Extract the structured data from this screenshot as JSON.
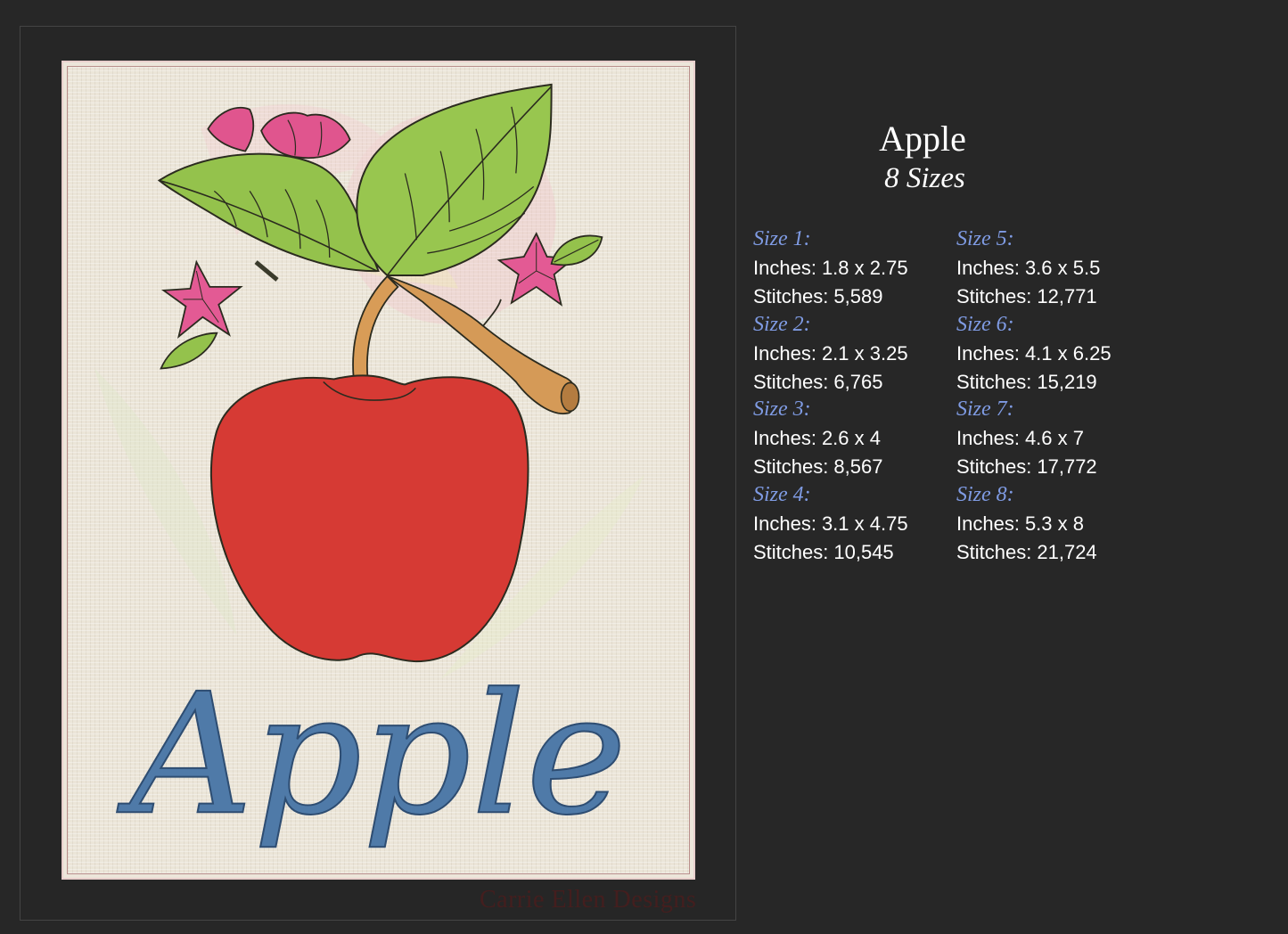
{
  "design": {
    "embroidered_text": "Apple",
    "watermark": "Carrie Ellen Designs"
  },
  "info": {
    "title": "Apple",
    "subtitle": "8 Sizes",
    "inches_label": "Inches:",
    "stitches_label": "Stitches:",
    "sizes": [
      {
        "label": "Size 1:",
        "inches": "1.8 x 2.75",
        "stitches": "5,589"
      },
      {
        "label": "Size 2:",
        "inches": "2.1 x 3.25",
        "stitches": "6,765"
      },
      {
        "label": "Size 3:",
        "inches": "2.6 x 4",
        "stitches": "8,567"
      },
      {
        "label": "Size 4:",
        "inches": "3.1 x 4.75",
        "stitches": "10,545"
      },
      {
        "label": "Size 5:",
        "inches": "3.6 x 5.5",
        "stitches": "12,771"
      },
      {
        "label": "Size 6:",
        "inches": "4.1 x 6.25",
        "stitches": "15,219"
      },
      {
        "label": "Size 7:",
        "inches": "4.6 x 7",
        "stitches": "17,772"
      },
      {
        "label": "Size 8:",
        "inches": "5.3 x 8",
        "stitches": "21,724"
      }
    ]
  },
  "colors": {
    "background": "#272727",
    "apple_red": "#d63a34",
    "leaf_green": "#93c24a",
    "flower_pink": "#e0548e",
    "stem_tan": "#d69a55",
    "text_blue": "#4f7aa8",
    "size_label_blue": "#7f9be3"
  }
}
